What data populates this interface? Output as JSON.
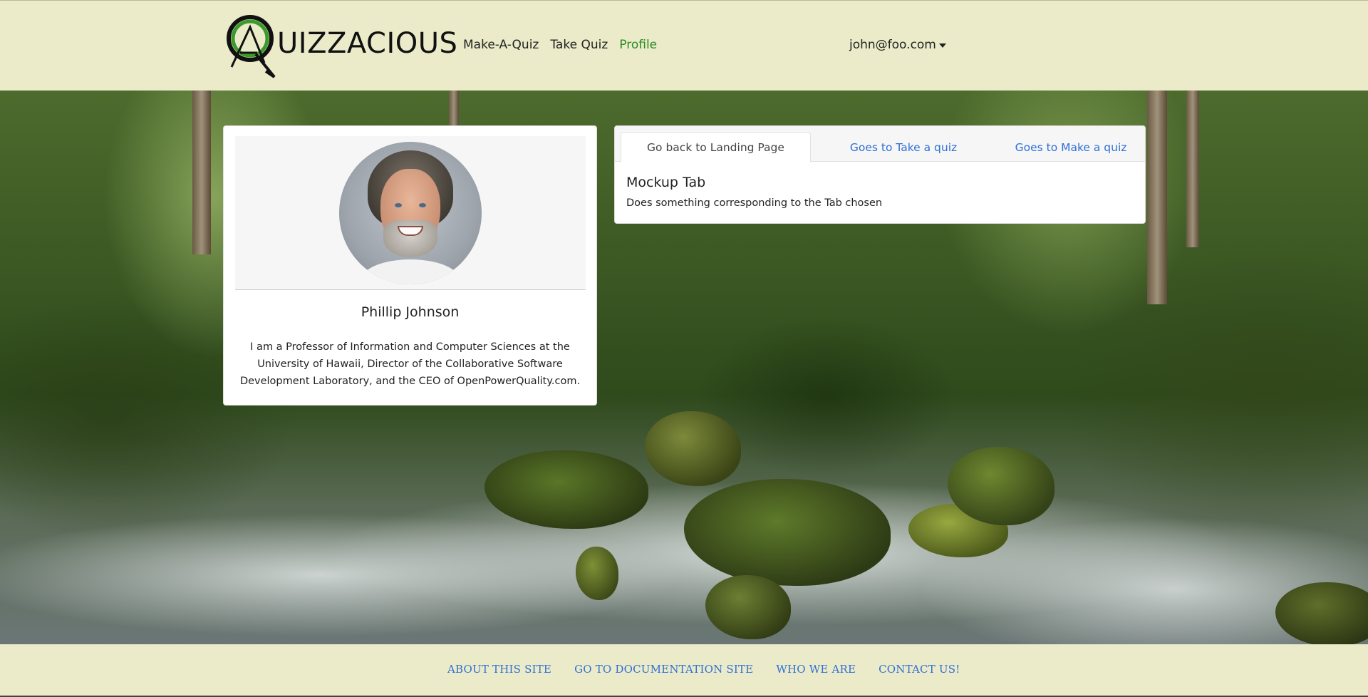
{
  "brand": {
    "name": "UIZZACIOUS",
    "logo": "quizzacious-q-logo"
  },
  "nav": {
    "items": [
      {
        "label": "Make-A-Quiz",
        "active": false
      },
      {
        "label": "Take Quiz",
        "active": false
      },
      {
        "label": "Profile",
        "active": true
      }
    ],
    "user": "john@foo.com"
  },
  "profile": {
    "name": "Phillip Johnson",
    "bio": "I am a Professor of Information and Computer Sciences at the University of Hawaii, Director of the Collaborative Software Development Laboratory, and the CEO of OpenPowerQuality.com."
  },
  "tabs": {
    "items": [
      {
        "label": "Go back to Landing Page",
        "active": true
      },
      {
        "label": "Goes to Take a quiz",
        "active": false
      },
      {
        "label": "Goes to Make a quiz",
        "active": false
      }
    ],
    "content": {
      "title": "Mockup Tab",
      "text": "Does something corresponding to the Tab chosen"
    }
  },
  "footer": {
    "links": [
      "ABOUT THIS SITE",
      "GO TO DOCUMENTATION SITE",
      "WHO WE ARE",
      "CONTACT US!"
    ]
  },
  "colors": {
    "bar_bg": "#ebebc9",
    "link_blue": "#2f6fd6",
    "active_green": "#2b8a25"
  }
}
